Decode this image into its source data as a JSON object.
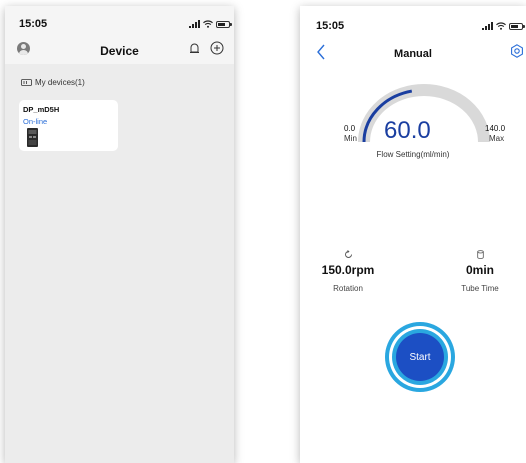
{
  "colors": {
    "accent_blue": "#1c4fc4",
    "ring_cyan": "#2aa7e0",
    "online_blue": "#2a6ed8",
    "gauge_track": "#d9d9d9",
    "gauge_fill": "#1a3ea0"
  },
  "device_screen": {
    "status_bar": {
      "time": "15:05"
    },
    "header": {
      "title": "Device"
    },
    "section": {
      "label": "My devices(1)",
      "icon": "devices-icon"
    },
    "devices": [
      {
        "name": "DP_mD5H",
        "status": "On-line",
        "icon": "pump-device-icon"
      }
    ],
    "icons": {
      "avatar": "user-avatar-icon",
      "message": "notification-icon",
      "add": "add-icon"
    }
  },
  "manual_screen": {
    "status_bar": {
      "time": "15:05"
    },
    "header": {
      "title": "Manual",
      "back_icon": "chevron-left-icon",
      "settings_icon": "settings-icon"
    },
    "gauge": {
      "value": "60.0",
      "min_value": "0.0",
      "min_label": "Min",
      "max_value": "140.0",
      "max_label": "Max",
      "label": "Flow Setting(ml/min)",
      "fraction": 0.43
    },
    "stats": {
      "rotation": {
        "value": "150.0rpm",
        "label": "Rotation",
        "icon": "rotation-icon"
      },
      "tube_time": {
        "value": "0min",
        "label": "Tube Time",
        "icon": "tube-icon"
      }
    },
    "start_button": {
      "label": "Start"
    }
  }
}
